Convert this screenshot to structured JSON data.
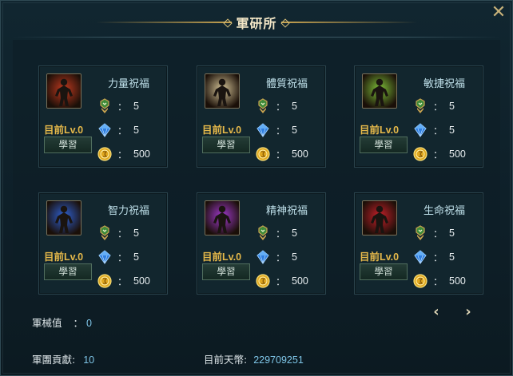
{
  "window": {
    "title": "軍研所",
    "close_symbol": "✕"
  },
  "cards": [
    {
      "name": "力量祝福",
      "icon": "strength-icon",
      "level": "目前Lv.0",
      "learn_label": "學習",
      "rank_req": "5",
      "crystal_req": "5",
      "gold_req": "500",
      "icon_color": "#c23a20"
    },
    {
      "name": "體質祝福",
      "icon": "constitution-icon",
      "level": "目前Lv.0",
      "learn_label": "學習",
      "rank_req": "5",
      "crystal_req": "5",
      "gold_req": "500",
      "icon_color": "#d8c79a"
    },
    {
      "name": "敏捷祝福",
      "icon": "agility-icon",
      "level": "目前Lv.0",
      "learn_label": "學習",
      "rank_req": "5",
      "crystal_req": "5",
      "gold_req": "500",
      "icon_color": "#7fc23a"
    },
    {
      "name": "智力祝福",
      "icon": "intellect-icon",
      "level": "目前Lv.0",
      "learn_label": "學習",
      "rank_req": "5",
      "crystal_req": "5",
      "gold_req": "500",
      "icon_color": "#2e62d6"
    },
    {
      "name": "精神祝福",
      "icon": "spirit-icon",
      "level": "目前Lv.0",
      "learn_label": "學習",
      "rank_req": "5",
      "crystal_req": "5",
      "gold_req": "500",
      "icon_color": "#a23ad0"
    },
    {
      "name": "生命祝福",
      "icon": "vitality-icon",
      "level": "目前Lv.0",
      "learn_label": "學習",
      "rank_req": "5",
      "crystal_req": "5",
      "gold_req": "500",
      "icon_color": "#c8202a"
    }
  ],
  "req_separator": "：",
  "pager": {
    "prev": "‹",
    "next": "›"
  },
  "footer": {
    "armament_label": "軍械值",
    "armament_sep": "：",
    "armament_value": "0",
    "contribution_label": "軍團貢獻:",
    "contribution_value": "10",
    "currency_label": "目前天幣:",
    "currency_value": "229709251"
  },
  "colors": {
    "accent_gold": "#e6b94a",
    "value_blue": "#7fc6e8"
  }
}
